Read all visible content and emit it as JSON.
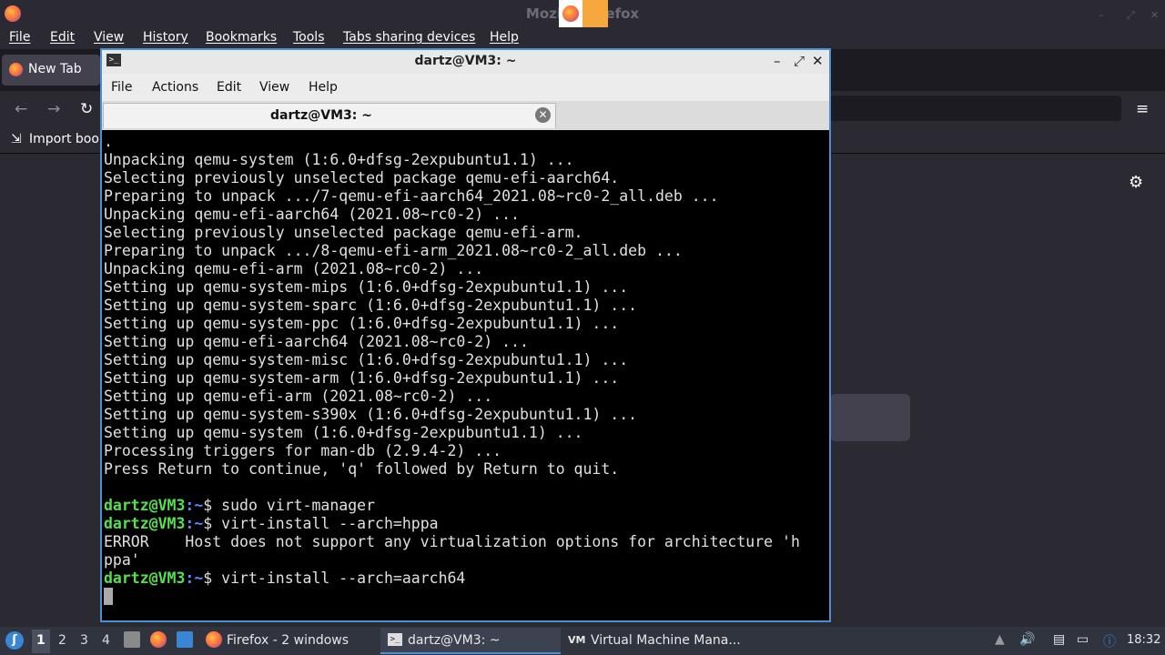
{
  "firefox": {
    "window_title": "Mozilla Firefox",
    "menu": [
      "File",
      "Edit",
      "View",
      "History",
      "Bookmarks",
      "Tools",
      "Tabs sharing devices",
      "Help"
    ],
    "tab_label": "New Tab",
    "bookmark_import": "Import bookm"
  },
  "terminal": {
    "window_title": "dartz@VM3: ~",
    "menu": [
      "File",
      "Actions",
      "Edit",
      "View",
      "Help"
    ],
    "tab_label": "dartz@VM3: ~",
    "prompt_user": "dartz@VM3",
    "prompt_path": ":~",
    "prompt_symbol": "$ ",
    "lines": [
      ".",
      "Unpacking qemu-system (1:6.0+dfsg-2expubuntu1.1) ...",
      "Selecting previously unselected package qemu-efi-aarch64.",
      "Preparing to unpack .../7-qemu-efi-aarch64_2021.08~rc0-2_all.deb ...",
      "Unpacking qemu-efi-aarch64 (2021.08~rc0-2) ...",
      "Selecting previously unselected package qemu-efi-arm.",
      "Preparing to unpack .../8-qemu-efi-arm_2021.08~rc0-2_all.deb ...",
      "Unpacking qemu-efi-arm (2021.08~rc0-2) ...",
      "Setting up qemu-system-mips (1:6.0+dfsg-2expubuntu1.1) ...",
      "Setting up qemu-system-sparc (1:6.0+dfsg-2expubuntu1.1) ...",
      "Setting up qemu-system-ppc (1:6.0+dfsg-2expubuntu1.1) ...",
      "Setting up qemu-efi-aarch64 (2021.08~rc0-2) ...",
      "Setting up qemu-system-misc (1:6.0+dfsg-2expubuntu1.1) ...",
      "Setting up qemu-system-arm (1:6.0+dfsg-2expubuntu1.1) ...",
      "Setting up qemu-efi-arm (2021.08~rc0-2) ...",
      "Setting up qemu-system-s390x (1:6.0+dfsg-2expubuntu1.1) ...",
      "Setting up qemu-system (1:6.0+dfsg-2expubuntu1.1) ...",
      "Processing triggers for man-db (2.9.4-2) ...",
      "Press Return to continue, 'q' followed by Return to quit.",
      ""
    ],
    "commands": [
      {
        "cmd": "sudo virt-manager",
        "output": []
      },
      {
        "cmd": "virt-install --arch=hppa",
        "output": [
          "ERROR    Host does not support any virtualization options for architecture 'h",
          "ppa'"
        ]
      },
      {
        "cmd": "virt-install --arch=aarch64",
        "output": []
      }
    ]
  },
  "taskbar": {
    "workspaces": [
      "1",
      "2",
      "3",
      "4"
    ],
    "tasks": [
      {
        "label": "Firefox - 2 windows"
      },
      {
        "label": "dartz@VM3: ~"
      },
      {
        "label": "Virtual Machine Mana..."
      }
    ],
    "clock": "18:32"
  }
}
